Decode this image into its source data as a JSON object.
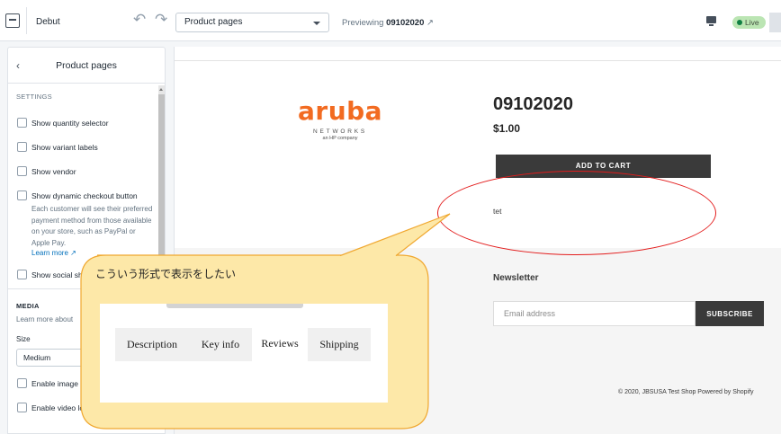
{
  "topbar": {
    "theme_name": "Debut",
    "page_select": "Product pages",
    "preview_prefix": "Previewing",
    "preview_product": "09102020",
    "live_badge": "Live",
    "icons": [
      "exit-icon",
      "undo-icon",
      "redo-icon",
      "external-link-icon",
      "desktop-icon"
    ]
  },
  "sidebar": {
    "title": "Product pages",
    "settings_heading": "SETTINGS",
    "checkboxes": [
      {
        "label": "Show quantity selector",
        "checked": false
      },
      {
        "label": "Show variant labels",
        "checked": false
      },
      {
        "label": "Show vendor",
        "checked": false
      },
      {
        "label": "Show dynamic checkout button",
        "checked": false
      },
      {
        "label": "Show social sh",
        "checked": false
      }
    ],
    "checkout_help": "Each customer will see their preferred payment method from those available on your store, such as PayPal or Apple Pay.",
    "learn_more": "Learn more",
    "media_heading": "MEDIA",
    "media_help": "Learn more about",
    "size_label": "Size",
    "size_value": "Medium",
    "media_checkboxes": [
      {
        "label": "Enable image",
        "checked": false
      },
      {
        "label": "Enable video lo",
        "checked": false
      }
    ]
  },
  "preview": {
    "logo": {
      "word": "aruba",
      "sub": "NETWORKS",
      "tag": "an HP company"
    },
    "product_title": "09102020",
    "price": "$1.00",
    "add_to_cart": "ADD TO CART",
    "description": "tet",
    "newsletter_title": "Newsletter",
    "email_placeholder": "Email address",
    "subscribe": "SUBSCRIBE",
    "copyright": "© 2020, JBSUSA Test Shop Powered by Shopify"
  },
  "annotation": {
    "callout_text": "こういう形式で表示をしたい",
    "tabs": [
      {
        "label": "Description",
        "active": false
      },
      {
        "label": "Key info",
        "active": false
      },
      {
        "label": "Reviews",
        "active": true
      },
      {
        "label": "Shipping",
        "active": false
      }
    ],
    "colors": {
      "ellipse": "#e31c1c",
      "callout_fill": "#fde8a8",
      "callout_stroke": "#f0a830"
    }
  }
}
